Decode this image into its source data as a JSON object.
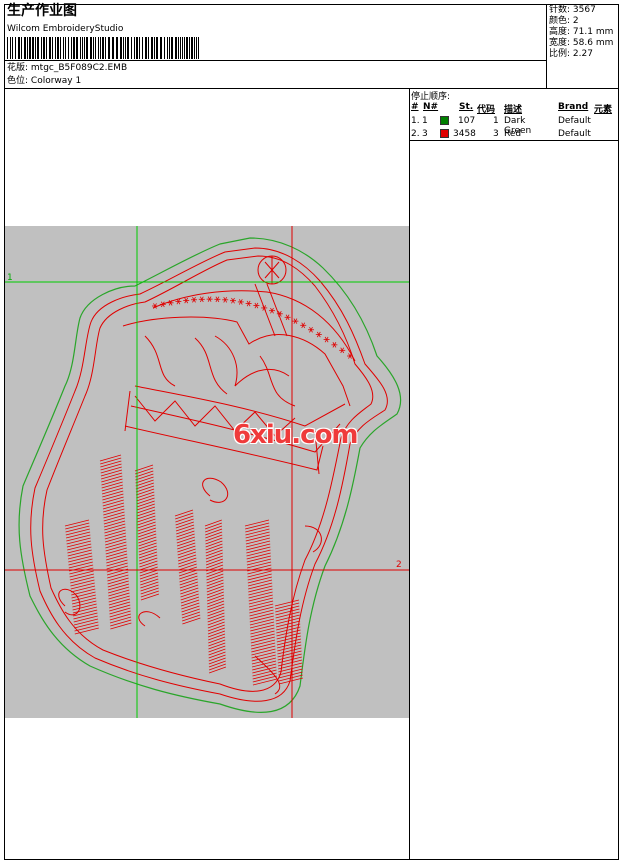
{
  "header": {
    "title": "生产作业图",
    "software": "Wilcom EmbroideryStudio",
    "design_label": "花版: ",
    "design_value": "mtgc_B5F089C2.EMB",
    "colorway_label": "色位: ",
    "colorway_value": "Colorway 1"
  },
  "stats": [
    {
      "label": "针数:",
      "value": "3567"
    },
    {
      "label": "颜色:",
      "value": "2"
    },
    {
      "label": "高度:",
      "value": "71.1 mm"
    },
    {
      "label": "宽度:",
      "value": "58.6 mm"
    },
    {
      "label": "比例:",
      "value": "2.27"
    }
  ],
  "stop_sequence": {
    "title": "停止顺序:",
    "columns": [
      "#",
      "N#",
      "St.",
      "代码",
      "描述",
      "Brand",
      "元素"
    ],
    "rows": [
      {
        "idx": "1.",
        "n": "1",
        "color": "#008000",
        "st": "107",
        "code": "1",
        "desc": "Dark Green",
        "brand": "Default"
      },
      {
        "idx": "2.",
        "n": "3",
        "color": "#e00000",
        "st": "3458",
        "code": "3",
        "desc": "Red",
        "brand": "Default"
      }
    ]
  },
  "canvas": {
    "marker_1": "1",
    "marker_2": "2",
    "watermark": "6xiu.com"
  }
}
